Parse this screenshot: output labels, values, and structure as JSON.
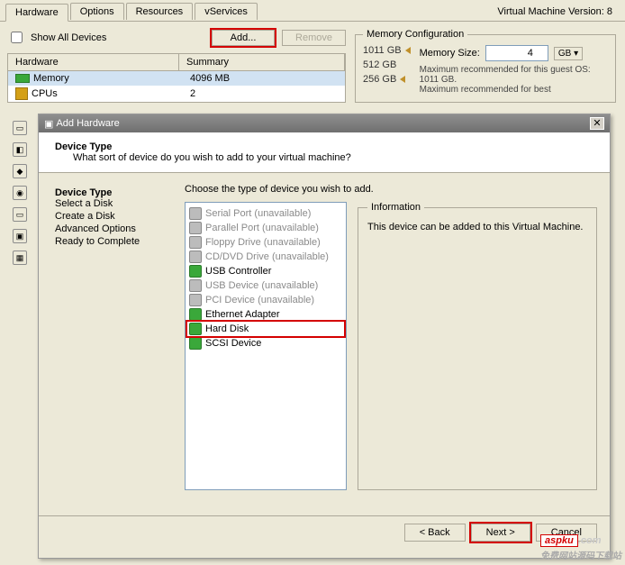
{
  "tabs": {
    "hardware": "Hardware",
    "options": "Options",
    "resources": "Resources",
    "vservices": "vServices"
  },
  "vm_version": "Virtual Machine Version: 8",
  "show_all": "Show All Devices",
  "buttons": {
    "add": "Add...",
    "remove": "Remove"
  },
  "hw_head": {
    "col1": "Hardware",
    "col2": "Summary"
  },
  "hw_rows": {
    "mem": {
      "name": "Memory",
      "summary": "4096 MB"
    },
    "cpu": {
      "name": "CPUs",
      "summary": "2"
    }
  },
  "mem_cfg": {
    "title": "Memory Configuration",
    "scale": {
      "s1": "1011 GB",
      "s2": "512 GB",
      "s3": "256 GB"
    },
    "size_label": "Memory Size:",
    "size_value": "4",
    "unit": "GB ▾",
    "rec1": "Maximum recommended for this guest OS: 1011 GB.",
    "rec2": "Maximum recommended for best"
  },
  "dialog": {
    "title": "Add Hardware",
    "device_type": "Device Type",
    "prompt_sub": "What sort of device do you wish to add to your virtual machine?",
    "steps": {
      "dt": "Device Type",
      "s1": "Select a Disk",
      "s2": "Create a Disk",
      "s3": "Advanced Options",
      "s4": "Ready to Complete"
    },
    "choose": "Choose the type of device you wish to add.",
    "devices": {
      "serial": "Serial Port (unavailable)",
      "parallel": "Parallel Port (unavailable)",
      "floppy": "Floppy Drive (unavailable)",
      "cd": "CD/DVD Drive (unavailable)",
      "usbctrl": "USB Controller",
      "usbdev": "USB Device (unavailable)",
      "pci": "PCI Device (unavailable)",
      "eth": "Ethernet Adapter",
      "hd": "Hard Disk",
      "scsi": "SCSI Device"
    },
    "info_title": "Information",
    "info_text": "This device can be added to this Virtual Machine.",
    "back": "< Back",
    "next": "Next >",
    "cancel": "Cancel"
  },
  "watermark": {
    "brand": "aspku",
    "rest": ".com",
    "sub": "免费网站源码下载站"
  }
}
